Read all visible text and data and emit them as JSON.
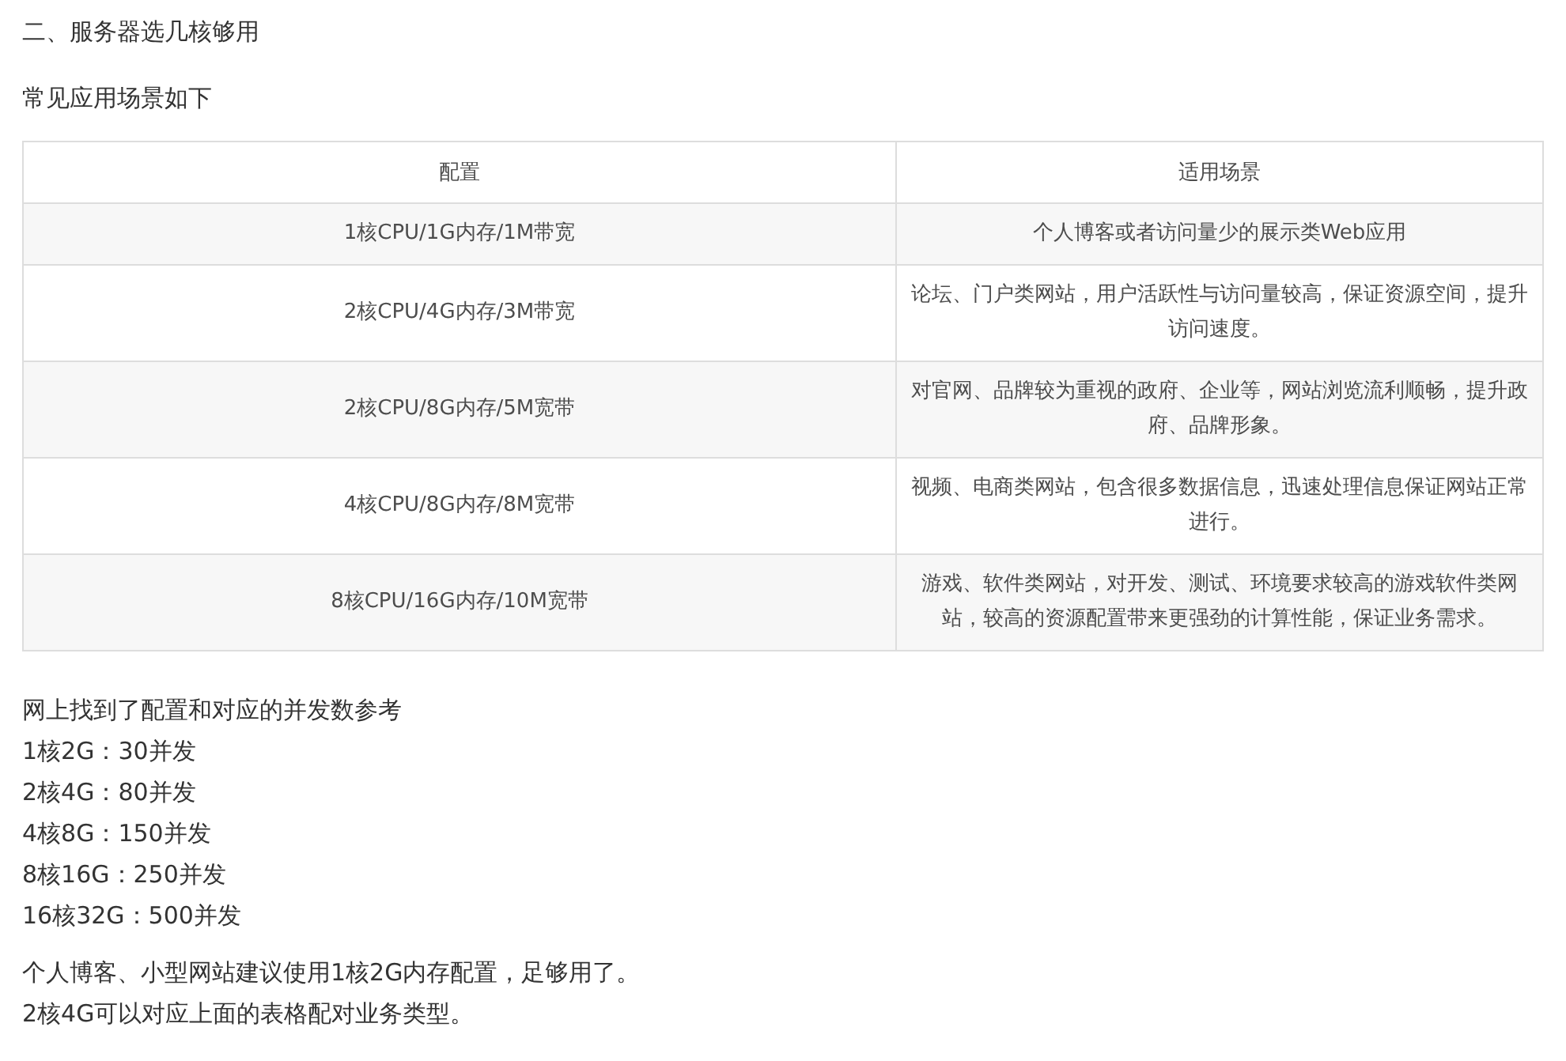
{
  "heading": "二、服务器选几核够用",
  "intro": "常见应用场景如下",
  "table": {
    "columns": [
      "配置",
      "适用场景"
    ],
    "rows": [
      {
        "config": "1核CPU/1G内存/1M带宽",
        "scenario": "个人博客或者访问量少的展示类Web应用"
      },
      {
        "config": "2核CPU/4G内存/3M带宽",
        "scenario": "论坛、门户类网站，用户活跃性与访问量较高，保证资源空间，提升访问速度。"
      },
      {
        "config": "2核CPU/8G内存/5M宽带",
        "scenario": "对官网、品牌较为重视的政府、企业等，网站浏览流利顺畅，提升政府、品牌形象。"
      },
      {
        "config": "4核CPU/8G内存/8M宽带",
        "scenario": "视频、电商类网站，包含很多数据信息，迅速处理信息保证网站正常进行。"
      },
      {
        "config": "8核CPU/16G内存/10M宽带",
        "scenario": "游戏、软件类网站，对开发、测试、环境要求较高的游戏软件类网站，较高的资源配置带来更强劲的计算性能，保证业务需求。"
      }
    ]
  },
  "reference_lines": [
    "网上找到了配置和对应的并发数参考",
    "1核2G：30并发",
    "2核4G：80并发",
    "4核8G：150并发",
    "8核16G：250并发",
    "16核32G：500并发"
  ],
  "summary_lines": [
    "个人博客、小型网站建议使用1核2G内存配置，足够用了。",
    "2核4G可以对应上面的表格配对业务类型。"
  ]
}
